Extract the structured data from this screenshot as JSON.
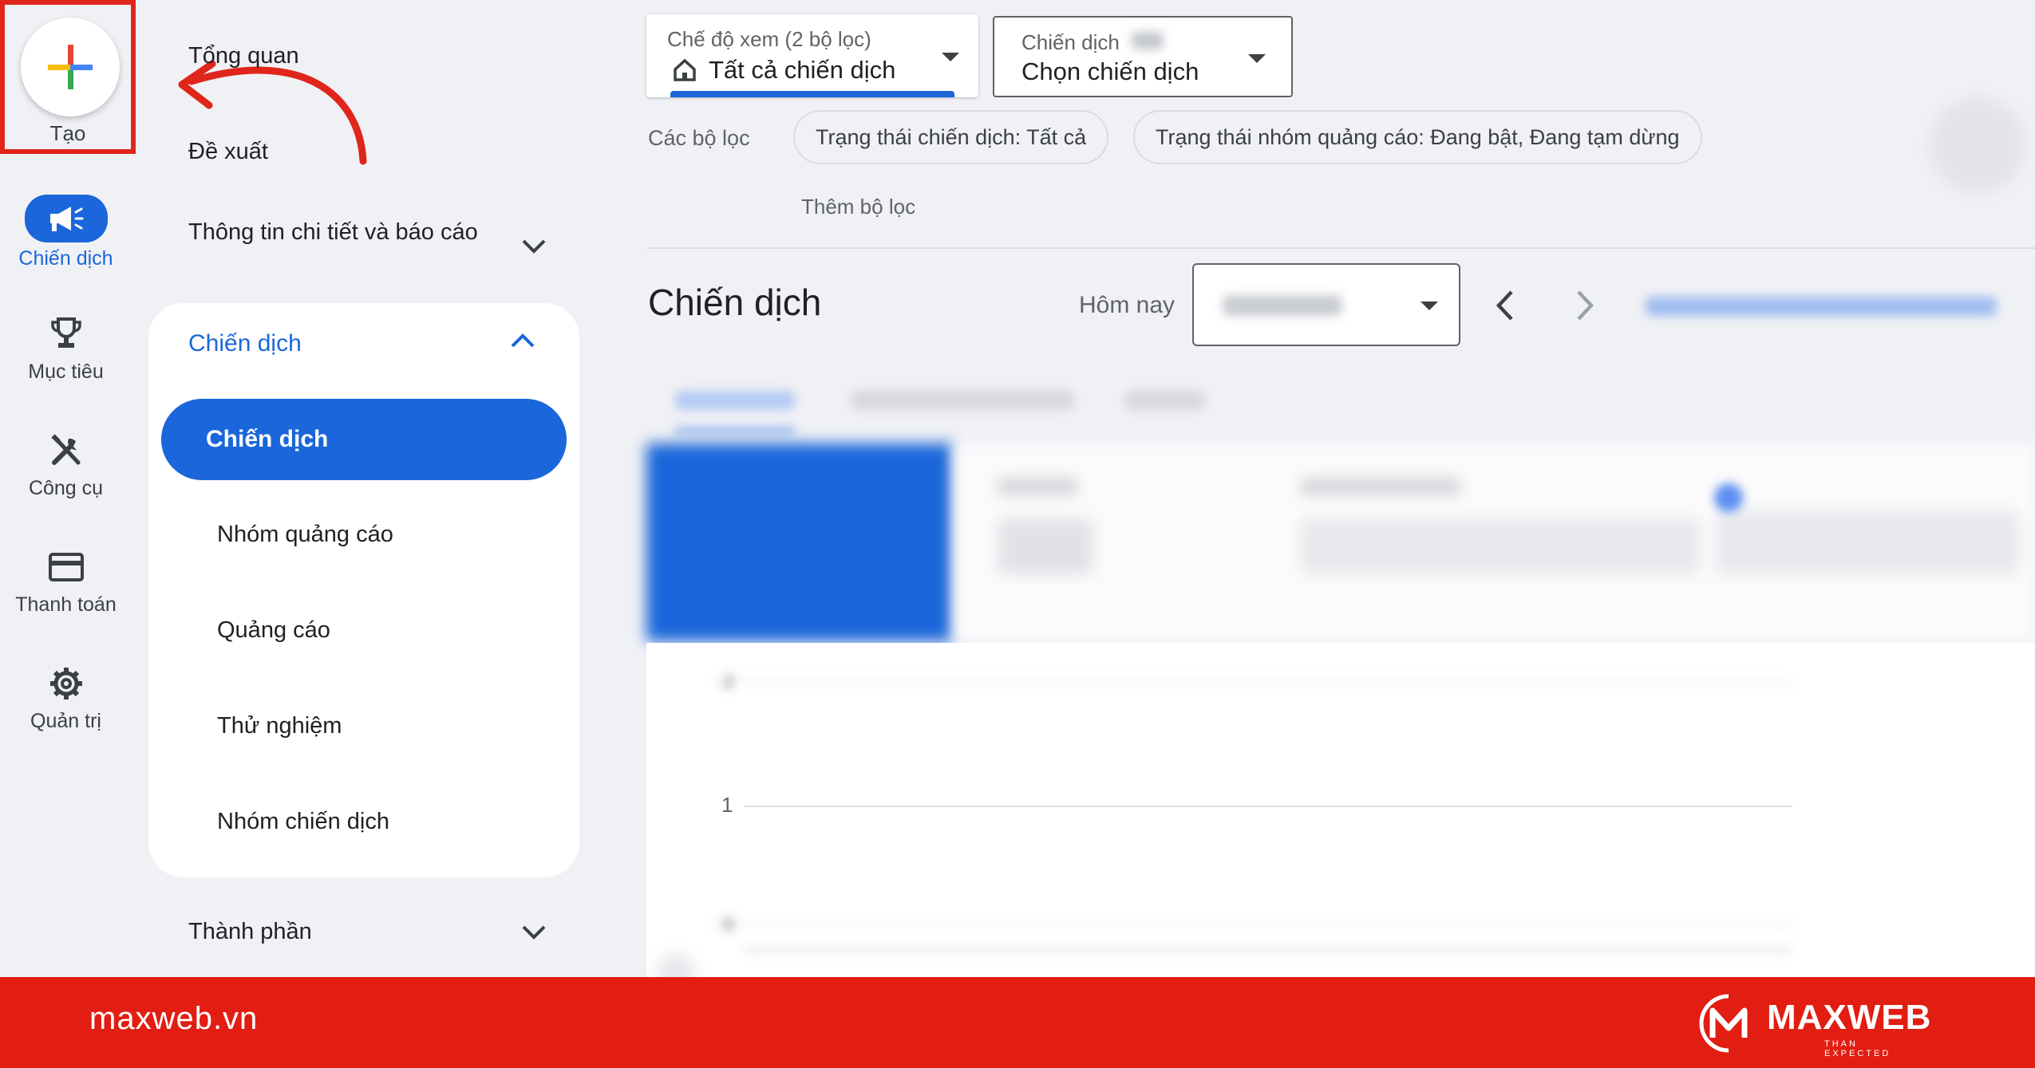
{
  "rail": {
    "create_label": "Tạo",
    "items": [
      {
        "label": "Chiến dịch",
        "icon": "megaphone-icon",
        "active": true
      },
      {
        "label": "Mục tiêu",
        "icon": "trophy-icon",
        "active": false
      },
      {
        "label": "Công cụ",
        "icon": "tools-icon",
        "active": false
      },
      {
        "label": "Thanh toán",
        "icon": "credit-card-icon",
        "active": false
      },
      {
        "label": "Quản trị",
        "icon": "gear-icon",
        "active": false
      }
    ]
  },
  "nav": {
    "overview": "Tổng quan",
    "recommendations": "Đề xuất",
    "insights": "Thông tin chi tiết và báo cáo",
    "campaigns_group": "Chiến dịch",
    "campaigns_sub": [
      {
        "label": "Chiến dịch",
        "active": true
      },
      {
        "label": "Nhóm quảng cáo",
        "active": false
      },
      {
        "label": "Quảng cáo",
        "active": false
      },
      {
        "label": "Thử nghiệm",
        "active": false
      },
      {
        "label": "Nhóm chiến dịch",
        "active": false
      }
    ],
    "assets": "Thành phần"
  },
  "header": {
    "view_mode": {
      "small": "Chế độ xem (2 bộ lọc)",
      "value": "Tất cả chiến dịch"
    },
    "campaign_picker": {
      "small": "Chiến dịch",
      "value": "Chọn chiến dịch"
    },
    "filters_label": "Các bộ lọc",
    "chips": [
      "Trạng thái chiến dịch: Tất cả",
      "Trạng thái nhóm quảng cáo: Đang bật, Đang tạm dừng"
    ],
    "add_filter": "Thêm bộ lọc"
  },
  "main": {
    "title": "Chiến dịch",
    "date_label": "Hôm nay",
    "chart": {
      "y_ticks": [
        "2",
        "1",
        "0"
      ]
    }
  },
  "footer": {
    "site": "maxweb.vn",
    "brand": "MAXWEB",
    "tagline": "THAN EXPECTED"
  },
  "colors": {
    "accent": "#1a66da",
    "footer": "#e21d12",
    "highlight_box": "#e0261b"
  }
}
